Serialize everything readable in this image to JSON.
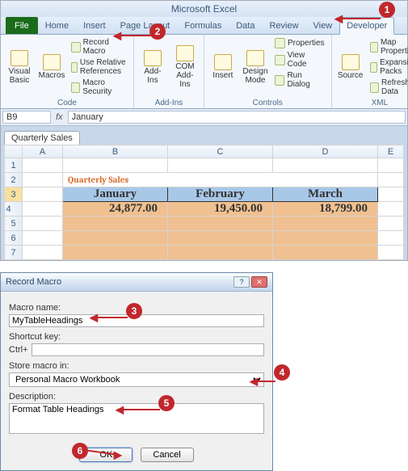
{
  "app": {
    "title": "Microsoft Excel"
  },
  "tabs": {
    "file": "File",
    "home": "Home",
    "insert": "Insert",
    "page_layout": "Page Layout",
    "formulas": "Formulas",
    "data": "Data",
    "review": "Review",
    "view": "View",
    "developer": "Developer"
  },
  "ribbon": {
    "code": {
      "label": "Code",
      "visual_basic": "Visual\nBasic",
      "macros": "Macros",
      "record_macro": "Record Macro",
      "use_relative": "Use Relative References",
      "macro_security": "Macro Security"
    },
    "addins": {
      "label": "Add-Ins",
      "addins": "Add-Ins",
      "com_addins": "COM\nAdd-Ins"
    },
    "controls": {
      "label": "Controls",
      "insert": "Insert",
      "design_mode": "Design\nMode",
      "properties": "Properties",
      "view_code": "View Code",
      "run_dialog": "Run Dialog"
    },
    "xml": {
      "label": "XML",
      "source": "Source",
      "map_properties": "Map Properties",
      "expansion_packs": "Expansion Packs",
      "refresh_data": "Refresh Data"
    }
  },
  "namebox": "B9",
  "formula": "January",
  "fx_label": "fx",
  "doc_tab": "Quarterly Sales",
  "columns": [
    "A",
    "B",
    "C",
    "D",
    "E"
  ],
  "rows": [
    "1",
    "2",
    "3",
    "4",
    "5",
    "6",
    "7"
  ],
  "sheet": {
    "title": "Quarterly Sales",
    "headers": [
      "January",
      "February",
      "March"
    ],
    "values": [
      "24,877.00",
      "19,450.00",
      "18,799.00"
    ]
  },
  "dialog": {
    "title": "Record Macro",
    "macro_name_label": "Macro name:",
    "macro_name": "MyTableHeadings",
    "shortcut_label": "Shortcut key:",
    "ctrl_label": "Ctrl+",
    "shortcut": "",
    "store_label": "Store macro in:",
    "store": "Personal Macro Workbook",
    "description_label": "Description:",
    "description": "Format Table Headings",
    "ok": "OK",
    "cancel": "Cancel"
  },
  "callouts": {
    "c1": "1",
    "c2": "2",
    "c3": "3",
    "c4": "4",
    "c5": "5",
    "c6": "6"
  }
}
